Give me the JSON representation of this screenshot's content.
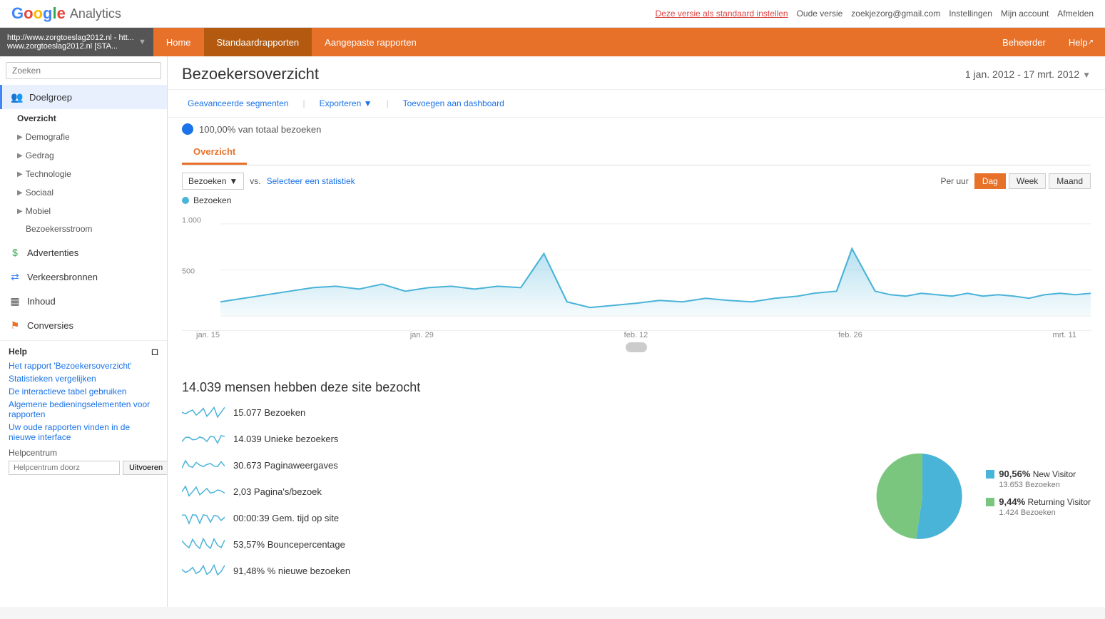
{
  "header": {
    "logo_google": "Google",
    "logo_analytics": "Analytics",
    "set_default": "Deze versie als standaard instellen",
    "old_version": "Oude versie",
    "email": "zoekjezorg@gmail.com",
    "settings": "Instellingen",
    "my_account": "Mijn account",
    "logout": "Afmelden"
  },
  "navbar": {
    "site_url_line1": "http://www.zorgtoeslag2012.nl - htt...",
    "site_url_line2": "www.zorgtoeslag2012.nl [STA...",
    "home": "Home",
    "standard_reports": "Standaardrapporten",
    "custom_reports": "Aangepaste rapporten",
    "admin": "Beheerder",
    "help": "Help"
  },
  "sidebar": {
    "search_placeholder": "Zoeken",
    "doelgroep": "Doelgroep",
    "overzicht": "Overzicht",
    "demografie": "Demografie",
    "gedrag": "Gedrag",
    "technologie": "Technologie",
    "sociaal": "Sociaal",
    "mobiel": "Mobiel",
    "bezoekersstroom": "Bezoekersstroom",
    "advertenties": "Advertenties",
    "verkeersbronnen": "Verkeersbronnen",
    "inhoud": "Inhoud",
    "conversies": "Conversies",
    "help_title": "Help",
    "help_links": [
      "Het rapport 'Bezoekersoverzicht'",
      "Statistieken vergelijken",
      "De interactieve tabel gebruiken",
      "Algemene bedieningselementen voor rapporten",
      "Uw oude rapporten vinden in de nieuwe interface"
    ],
    "helpcentrum_label": "Helpcentrum",
    "helpcentrum_placeholder": "Helpcentrum doorz",
    "helpcentrum_btn": "Uitvoeren"
  },
  "content": {
    "page_title": "Bezoekersoverzicht",
    "date_range": "1 jan. 2012 - 17 mrt. 2012",
    "advanced_segments": "Geavanceerde segmenten",
    "exporteren": "Exporteren",
    "toevoegen": "Toevoegen aan dashboard",
    "segment_pct": "100,00% van totaal bezoeken",
    "overview_tab": "Overzicht",
    "metric_label": "Bezoeken",
    "vs_label": "vs.",
    "compare_label": "Selecteer een statistiek",
    "per_uur": "Per uur",
    "dag": "Dag",
    "week": "Week",
    "maand": "Maand",
    "bezoeken_legend": "Bezoeken",
    "y_label_1000": "1.000",
    "y_label_500": "500",
    "x_labels": [
      "jan. 15",
      "jan. 29",
      "feb. 12",
      "feb. 26",
      "mrt. 11"
    ],
    "headline": "14.039 mensen hebben deze site bezocht",
    "stats": [
      {
        "value": "15.077",
        "label": "Bezoeken"
      },
      {
        "value": "14.039",
        "label": "Unieke bezoekers"
      },
      {
        "value": "30.673",
        "label": "Paginaweergaves"
      },
      {
        "value": "2,03",
        "label": "Pagina's/bezoek"
      },
      {
        "value": "00:00:39",
        "label": "Gem. tijd op site"
      },
      {
        "value": "53,57%",
        "label": "Bouncepercentage"
      },
      {
        "value": "91,48%",
        "label": "% nieuwe bezoeken"
      }
    ],
    "pie": {
      "new_visitor_pct": "90,56%",
      "new_visitor_label": "New Visitor",
      "new_visitor_visits": "13.653 Bezoeken",
      "returning_pct": "9,44%",
      "returning_label": "Returning Visitor",
      "returning_visits": "1.424 Bezoeken",
      "new_color": "#4ab3d8",
      "returning_color": "#7bc67e"
    }
  }
}
